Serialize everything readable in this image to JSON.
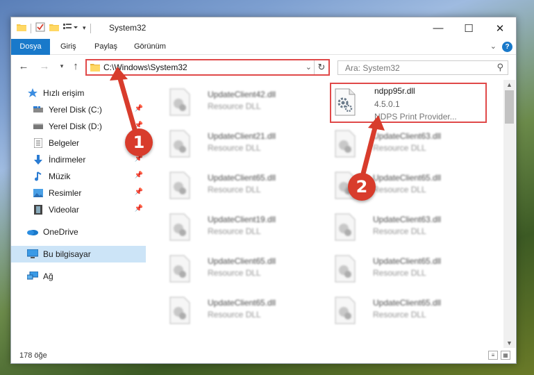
{
  "window": {
    "title": "System32",
    "controls": {
      "minimize": "—",
      "maximize": "☐",
      "close": "✕"
    }
  },
  "ribbon": {
    "tabs": [
      "Dosya",
      "Giriş",
      "Paylaş",
      "Görünüm"
    ],
    "accent": "#1979ca"
  },
  "nav": {
    "address": "C:\\Windows\\System32",
    "search_placeholder": "Ara: System32"
  },
  "sidebar": {
    "items": [
      {
        "label": "Hızlı erişim",
        "icon": "star-icon"
      },
      {
        "label": "Yerel Disk (C:)",
        "icon": "drive-icon",
        "pinned": true
      },
      {
        "label": "Yerel Disk (D:)",
        "icon": "drive-icon",
        "pinned": true
      },
      {
        "label": "Belgeler",
        "icon": "documents-icon",
        "pinned": true
      },
      {
        "label": "İndirmeler",
        "icon": "download-icon",
        "pinned": true
      },
      {
        "label": "Müzik",
        "icon": "music-icon",
        "pinned": true
      },
      {
        "label": "Resimler",
        "icon": "pictures-icon",
        "pinned": true
      },
      {
        "label": "Videolar",
        "icon": "videos-icon",
        "pinned": true
      },
      {
        "label": "OneDrive",
        "icon": "cloud-icon"
      },
      {
        "label": "Bu bilgisayar",
        "icon": "computer-icon",
        "selected": true
      },
      {
        "label": "Ağ",
        "icon": "network-icon"
      }
    ]
  },
  "files": {
    "highlighted": {
      "name": "ndpp95r.dll",
      "version": "4.5.0.1",
      "desc": "NDPS Print Provider..."
    },
    "left": [
      {
        "name": "UpdateClient42.dll",
        "desc": "Resource DLL"
      },
      {
        "name": "UpdateClient21.dll",
        "desc": "Resource DLL"
      },
      {
        "name": "UpdateClient65.dll",
        "desc": "Resource DLL"
      },
      {
        "name": "UpdateClient19.dll",
        "desc": "Resource DLL"
      },
      {
        "name": "UpdateClient65.dll",
        "desc": "Resource DLL"
      },
      {
        "name": "UpdateClient65.dll",
        "desc": "Resource DLL"
      }
    ],
    "right": [
      {
        "name": "UpdateClient63.dll",
        "desc": "Resource DLL"
      },
      {
        "name": "UpdateClient65.dll",
        "desc": "Resource DLL"
      },
      {
        "name": "UpdateClient63.dll",
        "desc": "Resource DLL"
      },
      {
        "name": "UpdateClient65.dll",
        "desc": "Resource DLL"
      },
      {
        "name": "UpdateClient65.dll",
        "desc": "Resource DLL"
      }
    ]
  },
  "status": {
    "count": "178 öğe"
  },
  "annotations": {
    "step1": "1",
    "step2": "2",
    "color": "#d83c2c"
  }
}
